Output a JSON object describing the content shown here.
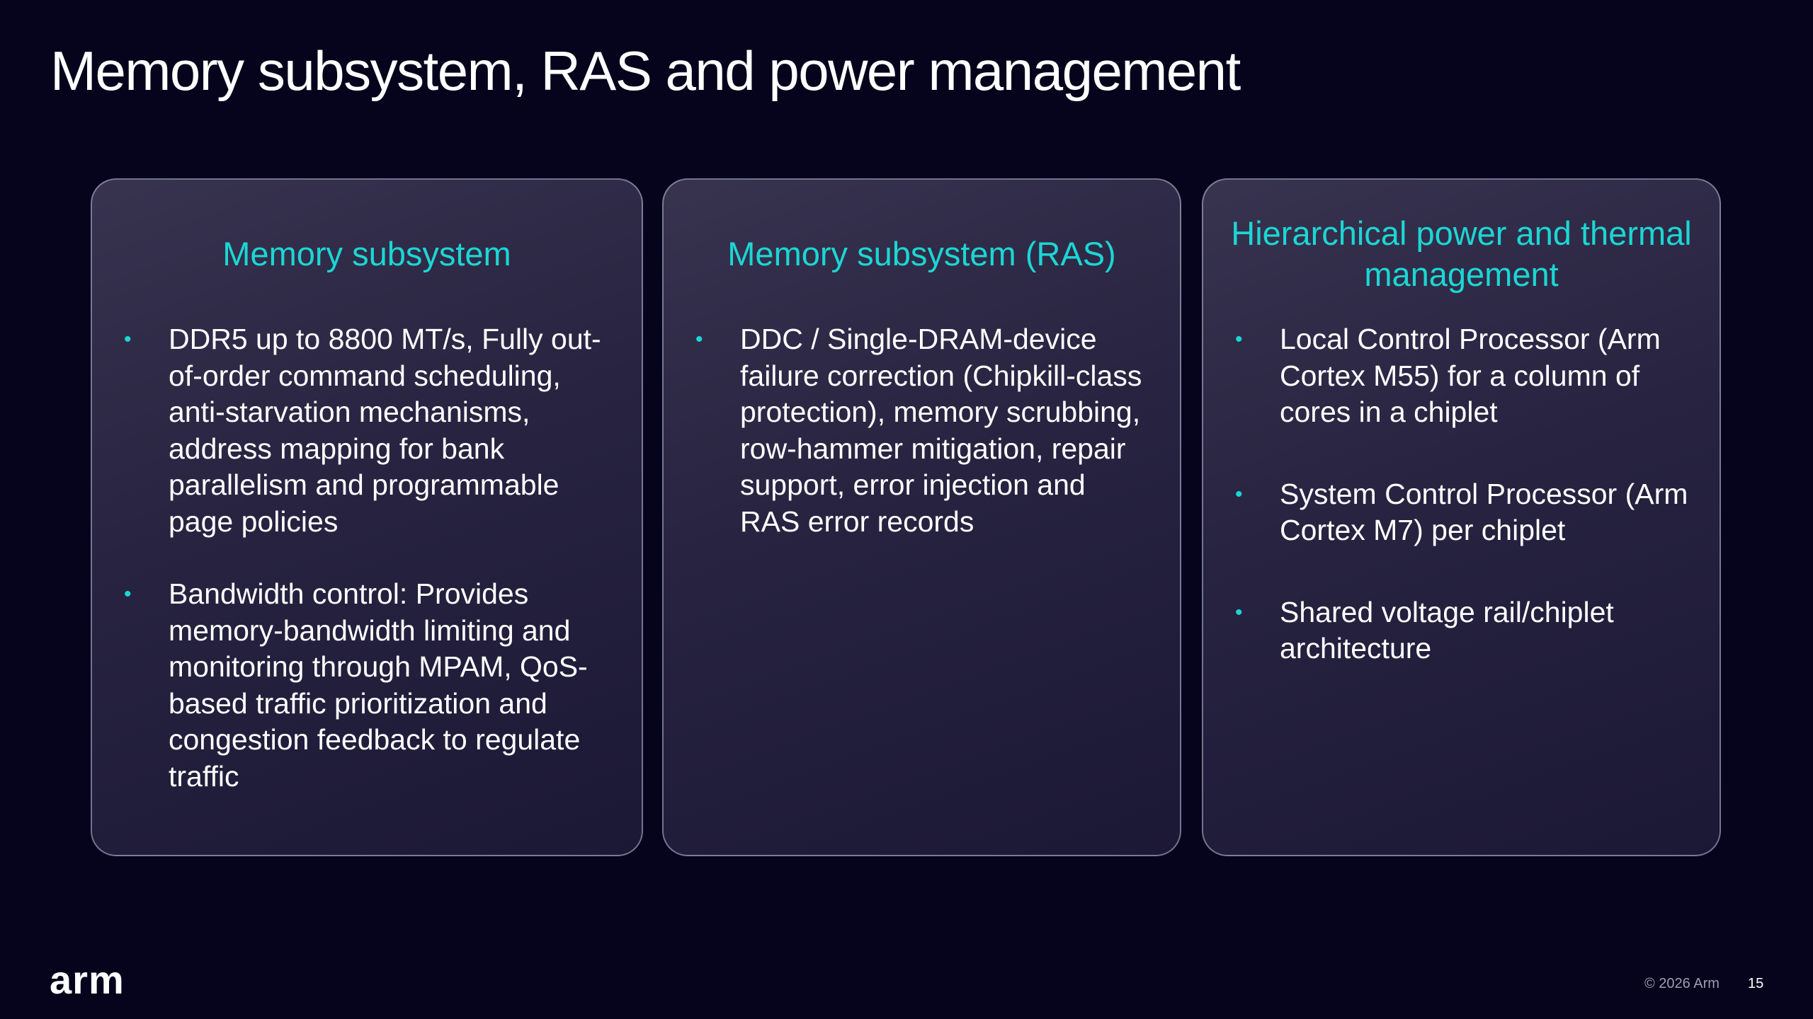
{
  "slide": {
    "title": "Memory subsystem, RAS and power management"
  },
  "cards": [
    {
      "heading": "Memory subsystem",
      "bullets": [
        "DDR5 up to 8800 MT/s, Fully out-of-order command scheduling, anti-starvation mechanisms, address mapping for bank parallelism and programmable page policies",
        "Bandwidth control: Provides memory-bandwidth limiting and monitoring through MPAM, QoS-based traffic prioritization and congestion feedback to regulate traffic"
      ]
    },
    {
      "heading": "Memory subsystem (RAS)",
      "bullets": [
        "DDC / Single-DRAM-device failure correction (Chipkill-class protection), memory scrubbing, row-hammer mitigation, repair support, error injection and RAS error records"
      ]
    },
    {
      "heading": "Hierarchical power and thermal management",
      "bullets": [
        "Local Control Processor (Arm Cortex M55) for a column of cores in a chiplet",
        "System Control Processor (Arm Cortex M7) per chiplet",
        "Shared voltage rail/chiplet architecture"
      ]
    }
  ],
  "bullet_glyph": "•",
  "footer": {
    "logo_text": "arm",
    "copyright": "© 2026 Arm",
    "page_number": "15"
  },
  "colors": {
    "background": "#06041c",
    "accent": "#1cd6d4",
    "text": "#ffffff"
  }
}
